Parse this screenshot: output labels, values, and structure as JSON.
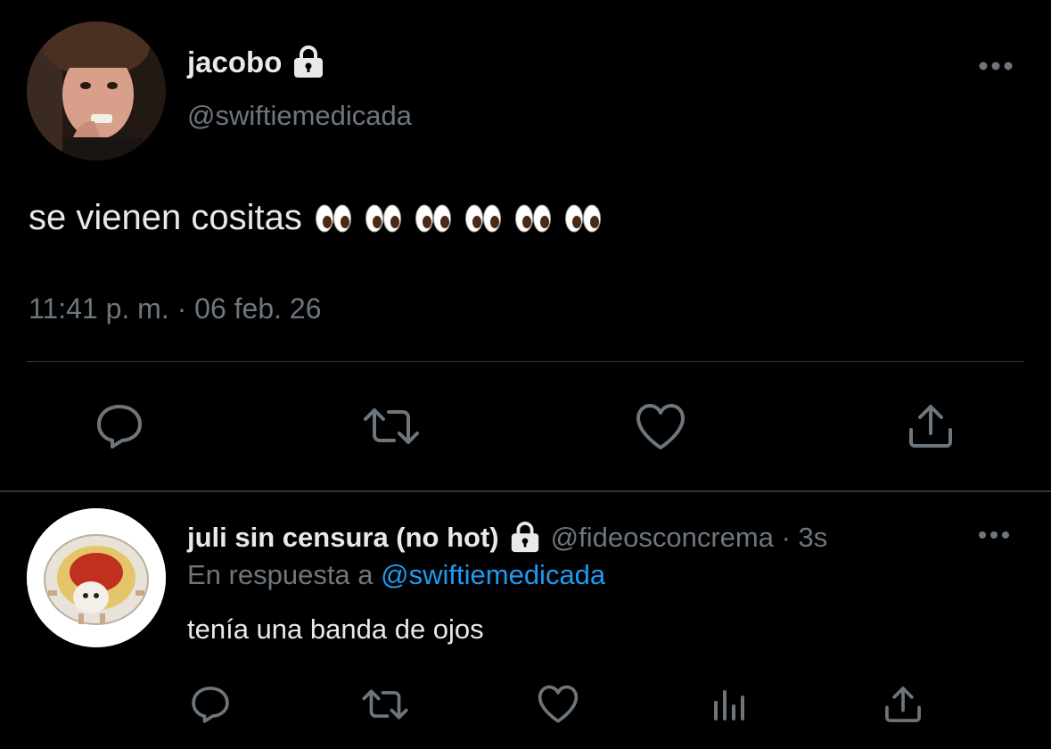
{
  "tweet": {
    "author": {
      "name": "jacobo",
      "handle": "@swiftiemedicada",
      "protected": true,
      "icon": "lock-icon"
    },
    "text": "se vienen cositas",
    "emoji": [
      "👀",
      "👀",
      "👀",
      "👀",
      "👀",
      "👀"
    ],
    "time": "11:41 p. m. · 06 feb. 26",
    "actions": [
      "reply-icon",
      "retweet-icon",
      "like-icon",
      "share-icon"
    ]
  },
  "reply": {
    "author": {
      "name": "juli sin censura (no hot)",
      "handle": "@fideosconcrema",
      "protected": true,
      "icon": "lock-icon"
    },
    "age": "3s",
    "separator": "·",
    "context_prefix": "En respuesta a",
    "context_mention": "@swiftiemedicada",
    "text": "tenía una banda de ojos",
    "actions": [
      "reply-icon",
      "retweet-icon",
      "like-icon",
      "analytics-icon",
      "share-icon"
    ]
  },
  "colors": {
    "background": "#000000",
    "text": "#e7e9ea",
    "secondary": "#6e767d",
    "link": "#1d9bf0",
    "divider": "#2f3336"
  }
}
